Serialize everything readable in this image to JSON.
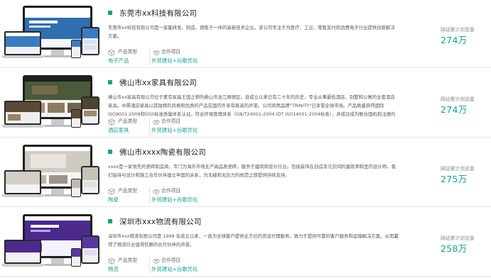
{
  "colors": {
    "accent": "#17a08e",
    "divider": "#e6e6e6"
  },
  "cases": [
    {
      "title": "东莞市xx科技有限公司",
      "description": "东莞市xx科技有限公司是一家集研发、制造、销售于一体的高新技术企业。该公司专注于为医疗、工业、零售支付和消费电子行业提供创新解决方案。",
      "product_type_label": "产品类型",
      "product_type_value": "电子产品",
      "project_label": "合作项目",
      "project_value": "外贸建站+谷歌优化",
      "stat_label": "网站累计浏览量",
      "stat_value": "274万",
      "thumb_theme": "blue"
    },
    {
      "title": "佛山市xx家具有限公司",
      "description": "佛山市xx家具有限公司位于素有家具王国之称的佛山市龙江顺德区。自成立以来已有二十年的历史，专业从事最低酒店、别墅和公寓的全套酒店家具。中票酒店家具以其独特的风格和优质的产品在国内外享有极高的声誉。公司商用品牌\"TRINITY\"已享誉全球市场。产品质量获得国际ISO9001:2008和SGS标准质量体系认证。符合环境管理体系（GB/T24001-2004 IDT ISO14001:2004标准），并成功成为联合国机构注册的家...",
      "product_type_label": "产品类型",
      "product_type_value": "酒店家具",
      "project_label": "合作项目",
      "project_value": "外贸建站+谷歌优化",
      "stat_label": "网站累计浏览量",
      "stat_value": "274万",
      "thumb_theme": "dark"
    },
    {
      "title": "佛山市xxxx陶瓷有限公司",
      "description": "xxxx是一家领先的瓷砖制造商，专门为海外市场生产高品质瓷砖，服务于建筑和设计行业。包括装饰在创造非凡空间的建筑师和室内设计师。我们接待与设计和施工合作伙伴建立牢固的关系，为无缝和无压力的规范之旅提供持续支持。",
      "product_type_label": "产品类型",
      "product_type_value": "陶瓷",
      "project_label": "合作项目",
      "project_value": "外贸建站+谷歌优化",
      "stat_label": "网站累计浏览量",
      "stat_value": "275万",
      "thumb_theme": "grey"
    },
    {
      "title": "深圳市xxx物流有限公司",
      "description": "深圳市xxx物流有限公司是 1998 年成立以来，一直为全球客户提供全方位的货运代理服务。致力于提供可靠的客户服务和运输解决方案，从而赢得了物流行业值得信赖的合作伙伴的声誉。",
      "product_type_label": "产品类型",
      "product_type_value": "物流",
      "project_label": "合作项目",
      "project_value": "外贸建站+谷歌优化",
      "stat_label": "网站累计浏览量",
      "stat_value": "258万",
      "thumb_theme": "purple"
    }
  ]
}
